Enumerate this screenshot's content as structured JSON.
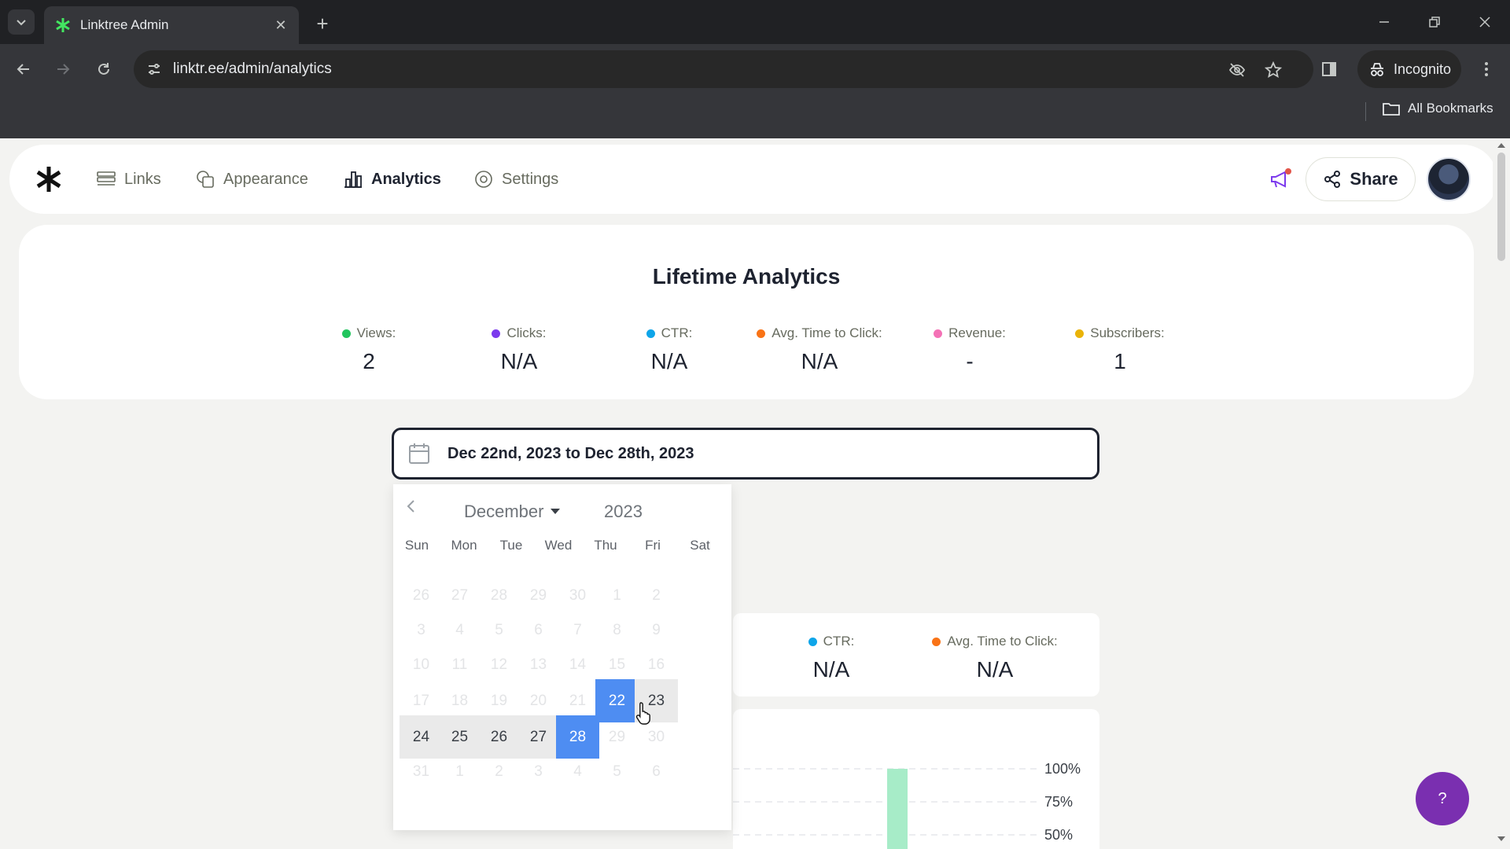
{
  "browser": {
    "tab_title": "Linktree Admin",
    "url": "linktr.ee/admin/analytics",
    "incognito_label": "Incognito",
    "bookmarks_label": "All Bookmarks"
  },
  "nav": {
    "items": [
      {
        "label": "Links",
        "icon": "links-icon",
        "active": false
      },
      {
        "label": "Appearance",
        "icon": "appearance-icon",
        "active": false
      },
      {
        "label": "Analytics",
        "icon": "analytics-icon",
        "active": true
      },
      {
        "label": "Settings",
        "icon": "settings-icon",
        "active": false
      }
    ],
    "share_label": "Share"
  },
  "lifetime": {
    "title": "Lifetime Analytics",
    "stats": [
      {
        "label": "Views:",
        "value": "2",
        "color": "#22c55e"
      },
      {
        "label": "Clicks:",
        "value": "N/A",
        "color": "#7c3aed"
      },
      {
        "label": "CTR:",
        "value": "N/A",
        "color": "#0ea5e9"
      },
      {
        "label": "Avg. Time to Click:",
        "value": "N/A",
        "color": "#f97316"
      },
      {
        "label": "Revenue:",
        "value": "-",
        "color": "#f472b6"
      },
      {
        "label": "Subscribers:",
        "value": "1",
        "color": "#eab308"
      }
    ]
  },
  "date_range": {
    "text": "Dec 22nd, 2023 to Dec 28th, 2023"
  },
  "calendar": {
    "month": "December",
    "year": "2023",
    "weekdays": [
      "Sun",
      "Mon",
      "Tue",
      "Wed",
      "Thu",
      "Fri",
      "Sat"
    ],
    "weeks": [
      [
        "26",
        "27",
        "28",
        "29",
        "30",
        "1",
        "2"
      ],
      [
        "3",
        "4",
        "5",
        "6",
        "7",
        "8",
        "9"
      ],
      [
        "10",
        "11",
        "12",
        "13",
        "14",
        "15",
        "16"
      ],
      [
        "17",
        "18",
        "19",
        "20",
        "21",
        "22",
        "23"
      ],
      [
        "24",
        "25",
        "26",
        "27",
        "28",
        "29",
        "30"
      ],
      [
        "31",
        "1",
        "2",
        "3",
        "4",
        "5",
        "6"
      ]
    ],
    "selected": [
      "22",
      "28"
    ],
    "in_range": [
      "23",
      "24",
      "25",
      "26",
      "27"
    ],
    "enabled_after_selection": [
      "23",
      "24",
      "25",
      "26",
      "27"
    ]
  },
  "period_stats": [
    {
      "label": "CTR:",
      "value": "N/A",
      "color": "#0ea5e9"
    },
    {
      "label": "Avg. Time to Click:",
      "value": "N/A",
      "color": "#f97316"
    }
  ],
  "chart": {
    "y_ticks": [
      "100%",
      "75%",
      "50%"
    ]
  },
  "help_label": "?"
}
